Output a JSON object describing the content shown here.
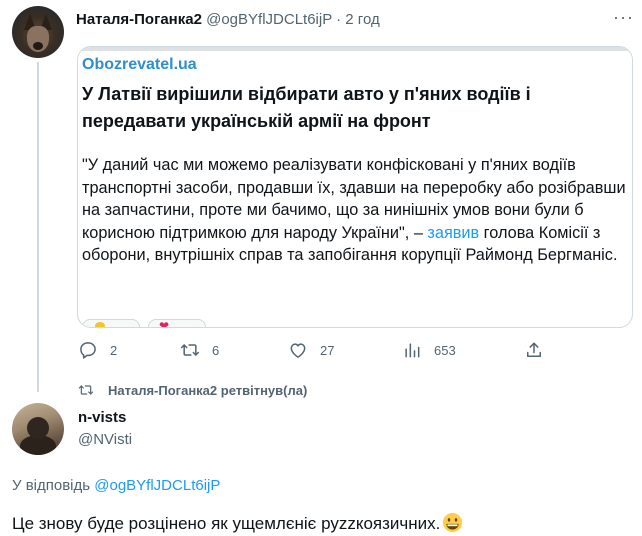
{
  "tweet": {
    "author_name": "Наталя-Поганка2",
    "author_handle": "@ogBYflJDCLt6ijP",
    "separator": "·",
    "time": "2 год",
    "more_icon": "more-icon",
    "card": {
      "source": "Obozrevatel.ua",
      "headline": "У Латвії  вирішили відбирати авто у п'яних водіїв і передавати українській армії на фронт",
      "quote_part1": "\"У даний час ми можемо реалізувати конфісковані у п'яних водіїв транспортні засоби, продавши їх, здавши на переробку або розібравши на запчастини, проте ми бачимо, що за нинішніх умов вони були б корисною підтримкою для народу України\", – ",
      "quote_link": "заявив",
      "quote_part2": " голова Комісії з оборони, внутрішніх справ та запобігання корупції Раймонд Бергманіс."
    },
    "actions": {
      "replies": "2",
      "retweets": "6",
      "likes": "27",
      "views": "653"
    }
  },
  "retweet_notice": "Наталя-Поганка2 ретвітнув(ла)",
  "reply": {
    "author_name": "n-vists",
    "author_handle": "@NVisti",
    "reply_to_prefix": "У відповідь ",
    "reply_to_handle": "@ogBYflJDCLt6ijP",
    "text": "Це знову буде розцінено як ущемлєніє руzzкоязичних.",
    "emoji_icon": "grinning-face-icon"
  },
  "colors": {
    "accent": "#1d9bf0",
    "source": "#2e8fcf",
    "muted": "#536471",
    "text": "#0f1419",
    "border": "#cfd9de"
  }
}
